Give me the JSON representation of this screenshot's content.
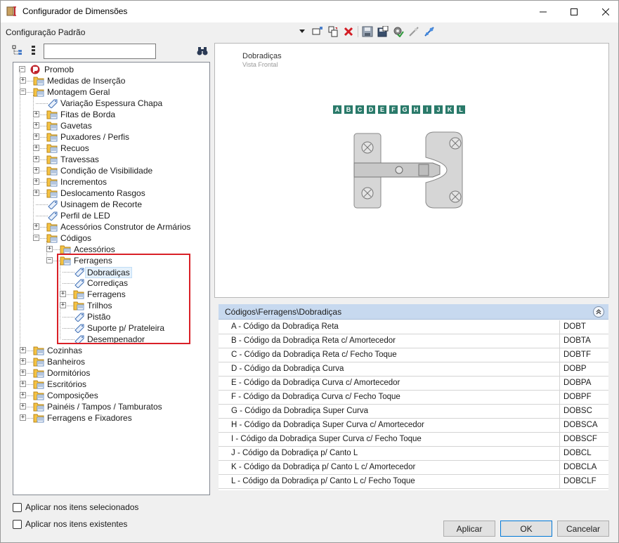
{
  "window": {
    "title": "Configurador de Dimensões"
  },
  "header": {
    "config_label": "Configuração Padrão"
  },
  "toolbar": {
    "icons": [
      "dropdown-arrow-icon",
      "add-dimension-icon",
      "copy-dimension-icon",
      "delete-icon",
      "save-icon",
      "save-as-icon",
      "settings-check-icon",
      "link-icon",
      "connect-icon"
    ]
  },
  "tree_search": {
    "value": ""
  },
  "tree": {
    "root": "Promob",
    "items": [
      {
        "label": "Medidas de Inserção",
        "level": 1,
        "type": "folder",
        "expand": "+"
      },
      {
        "label": "Montagem Geral",
        "level": 1,
        "type": "folder",
        "expand": "-"
      },
      {
        "label": "Variação Espessura Chapa",
        "level": 2,
        "type": "tag",
        "expand": ""
      },
      {
        "label": "Fitas de Borda",
        "level": 2,
        "type": "folder",
        "expand": "+"
      },
      {
        "label": "Gavetas",
        "level": 2,
        "type": "folder",
        "expand": "+"
      },
      {
        "label": "Puxadores / Perfis",
        "level": 2,
        "type": "folder",
        "expand": "+"
      },
      {
        "label": "Recuos",
        "level": 2,
        "type": "folder",
        "expand": "+"
      },
      {
        "label": "Travessas",
        "level": 2,
        "type": "folder",
        "expand": "+"
      },
      {
        "label": "Condição de Visibilidade",
        "level": 2,
        "type": "folder",
        "expand": "+"
      },
      {
        "label": "Incrementos",
        "level": 2,
        "type": "folder",
        "expand": "+"
      },
      {
        "label": "Deslocamento Rasgos",
        "level": 2,
        "type": "folder",
        "expand": "+"
      },
      {
        "label": "Usinagem de Recorte",
        "level": 2,
        "type": "tag",
        "expand": ""
      },
      {
        "label": "Perfil de LED",
        "level": 2,
        "type": "tag",
        "expand": ""
      },
      {
        "label": "Acessórios Construtor de Armários",
        "level": 2,
        "type": "folder",
        "expand": "+"
      },
      {
        "label": "Códigos",
        "level": 2,
        "type": "folder",
        "expand": "-"
      },
      {
        "label": "Acessórios",
        "level": 3,
        "type": "folder",
        "expand": "+"
      },
      {
        "label": "Ferragens",
        "level": 3,
        "type": "folder",
        "expand": "-"
      },
      {
        "label": "Dobradiças",
        "level": 4,
        "type": "tag",
        "expand": "",
        "selected": true
      },
      {
        "label": "Corrediças",
        "level": 4,
        "type": "tag",
        "expand": ""
      },
      {
        "label": "Ferragens",
        "level": 4,
        "type": "folder",
        "expand": "+"
      },
      {
        "label": "Trilhos",
        "level": 4,
        "type": "folder",
        "expand": "+"
      },
      {
        "label": "Pistão",
        "level": 4,
        "type": "tag",
        "expand": ""
      },
      {
        "label": "Suporte p/ Prateleira",
        "level": 4,
        "type": "tag",
        "expand": ""
      },
      {
        "label": "Desempenador",
        "level": 4,
        "type": "tag",
        "expand": ""
      },
      {
        "label": "Cozinhas",
        "level": 1,
        "type": "folder",
        "expand": "+"
      },
      {
        "label": "Banheiros",
        "level": 1,
        "type": "folder",
        "expand": "+"
      },
      {
        "label": "Dormitórios",
        "level": 1,
        "type": "folder",
        "expand": "+"
      },
      {
        "label": "Escritórios",
        "level": 1,
        "type": "folder",
        "expand": "+"
      },
      {
        "label": "Composições",
        "level": 1,
        "type": "folder",
        "expand": "+"
      },
      {
        "label": "Painéis / Tampos / Tamburatos",
        "level": 1,
        "type": "folder",
        "expand": "+"
      },
      {
        "label": "Ferragens e Fixadores",
        "level": 1,
        "type": "folder",
        "expand": "+"
      }
    ]
  },
  "preview": {
    "title": "Dobradiças",
    "subtitle": "Vista Frontal",
    "letters": [
      "A",
      "B",
      "C",
      "D",
      "E",
      "F",
      "G",
      "H",
      "I",
      "J",
      "K",
      "L"
    ],
    "accent": "#2a7a6a"
  },
  "grid": {
    "path": "Códigos\\Ferragens\\Dobradiças",
    "rows": [
      {
        "desc": "A - Código da Dobradiça Reta",
        "code": "DOBT"
      },
      {
        "desc": "B - Código da Dobradiça Reta c/ Amortecedor",
        "code": "DOBTA"
      },
      {
        "desc": "C - Código da Dobradiça Reta c/ Fecho Toque",
        "code": "DOBTF"
      },
      {
        "desc": "D - Código da Dobradiça Curva",
        "code": "DOBP"
      },
      {
        "desc": "E - Código da Dobradiça Curva c/ Amortecedor",
        "code": "DOBPA"
      },
      {
        "desc": "F - Código da Dobradiça Curva c/ Fecho Toque",
        "code": "DOBPF"
      },
      {
        "desc": "G - Código da Dobradiça Super Curva",
        "code": "DOBSC"
      },
      {
        "desc": "H - Código da Dobradiça Super Curva c/ Amortecedor",
        "code": "DOBSCA"
      },
      {
        "desc": "I - Código da Dobradiça Super Curva c/ Fecho Toque",
        "code": "DOBSCF"
      },
      {
        "desc": "J - Código da Dobradiça p/ Canto L",
        "code": "DOBCL"
      },
      {
        "desc": "K - Código da Dobradiça p/ Canto L c/ Amortecedor",
        "code": "DOBCLA"
      },
      {
        "desc": "L - Código da Dobradiça p/ Canto L c/ Fecho Toque",
        "code": "DOBCLF"
      }
    ]
  },
  "options": {
    "apply_selected": "Aplicar nos itens selecionados",
    "apply_existing": "Aplicar nos itens existentes"
  },
  "buttons": {
    "apply": "Aplicar",
    "ok": "OK",
    "cancel": "Cancelar"
  },
  "colors": {
    "grid_header": "#c7d9ef",
    "highlight": "#d92027",
    "folder": "#f5c242"
  }
}
